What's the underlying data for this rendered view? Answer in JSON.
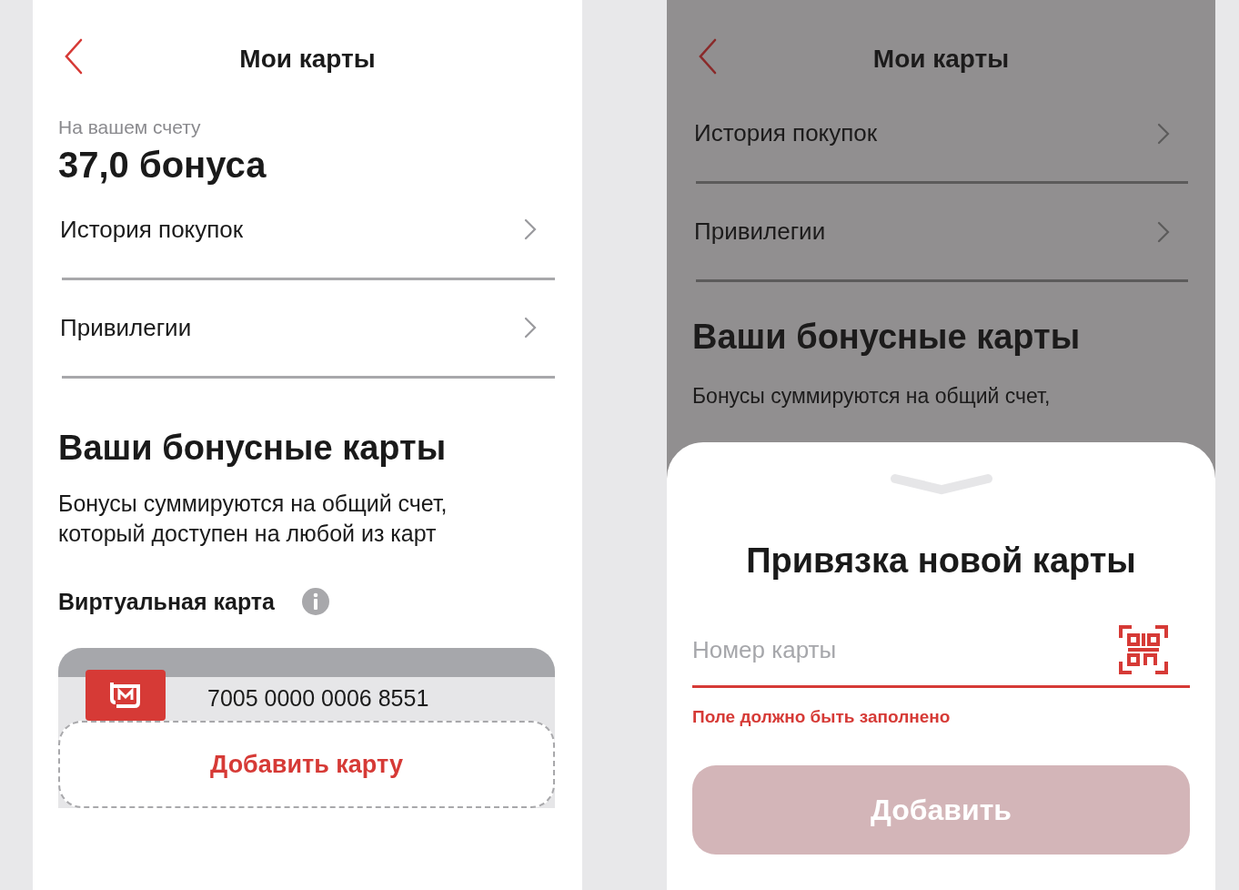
{
  "left_screen": {
    "header": {
      "title": "Мои карты"
    },
    "balance": {
      "label": "На вашем счету",
      "amount": "37,0 бонуса"
    },
    "menu": [
      {
        "label": "История покупок"
      },
      {
        "label": "Привилегии"
      }
    ],
    "section": {
      "title": "Ваши бонусные карты",
      "description": "Бонусы суммируются на общий счет, который доступен на любой из карт"
    },
    "virtual_card": {
      "label": "Виртуальная карта",
      "number": "7005 0000 0006 8551"
    },
    "add_card_button": "Добавить карту"
  },
  "right_screen": {
    "header": {
      "title": "Мои карты"
    },
    "menu": [
      {
        "label": "История покупок"
      },
      {
        "label": "Привилегии"
      }
    ],
    "section": {
      "title": "Ваши бонусные карты",
      "description": "Бонусы суммируются на общий счет,"
    },
    "sheet": {
      "title": "Привязка новой карты",
      "card_field": {
        "placeholder": "Номер карты",
        "error": true
      },
      "error_message": "Поле должно быть заполнено",
      "submit_button": {
        "label": "Добавить",
        "disabled": true
      }
    }
  }
}
